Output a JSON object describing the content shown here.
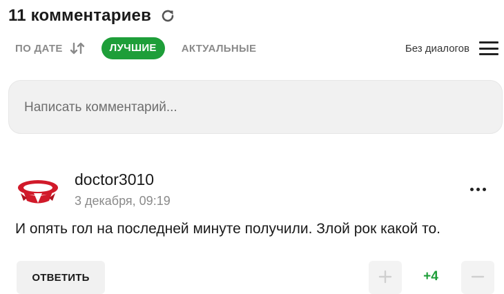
{
  "header": {
    "title": "11 комментариев",
    "refresh_icon": "refresh-icon"
  },
  "sort": {
    "by_date": "ПО ДАТЕ",
    "best": "ЛУЧШИЕ",
    "actual": "АКТУАЛЬНЫЕ",
    "active": "ЛУЧШИЕ",
    "sort_icon": "sort-arrows-icon",
    "threads_label": "Без диалогов",
    "menu_icon": "hamburger-icon"
  },
  "composer": {
    "placeholder": "Написать комментарий...",
    "value": ""
  },
  "comment": {
    "author": "doctor3010",
    "date": "3 декабря, 09:19",
    "text": "И опять гол на последней минуте получили. Злой рок какой то.",
    "reply_label": "ОТВЕТИТЬ",
    "score": "+4",
    "avatar_icon": "red-emblem-avatar-icon",
    "more_icon": "more-dots-icon",
    "upvote_icon": "plus-icon",
    "downvote_icon": "minus-icon"
  },
  "colors": {
    "accent": "#1e9e39",
    "muted": "#8a8a8a",
    "surface": "#f1f1f1",
    "text": "#1a1a1a",
    "avatar_red": "#d11a2a"
  }
}
